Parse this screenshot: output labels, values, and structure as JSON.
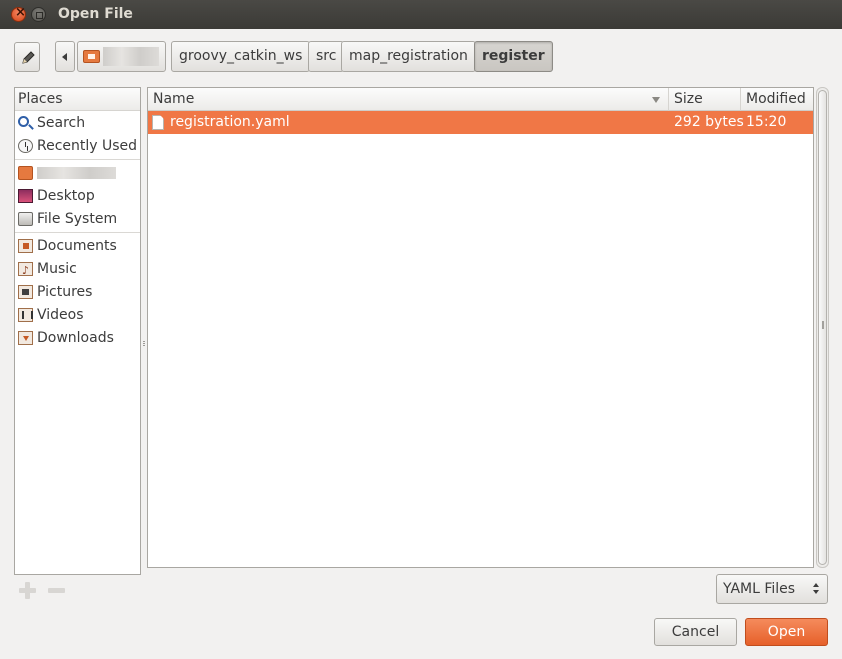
{
  "window": {
    "title": "Open File"
  },
  "pathbar": {
    "crumbs": [
      "groovy_catkin_ws",
      "src",
      "map_registration",
      "register"
    ]
  },
  "places": {
    "header": "Places",
    "items": [
      {
        "label": "Search",
        "icon": "search-icon"
      },
      {
        "label": "Recently Used",
        "icon": "recently-used-icon"
      },
      {
        "label": "",
        "icon": "home-folder-icon"
      },
      {
        "label": "Desktop",
        "icon": "desktop-icon"
      },
      {
        "label": "File System",
        "icon": "file-system-icon"
      },
      {
        "label": "Documents",
        "icon": "documents-folder-icon"
      },
      {
        "label": "Music",
        "icon": "music-folder-icon"
      },
      {
        "label": "Pictures",
        "icon": "pictures-folder-icon"
      },
      {
        "label": "Videos",
        "icon": "videos-folder-icon"
      },
      {
        "label": "Downloads",
        "icon": "downloads-folder-icon"
      }
    ]
  },
  "file_list": {
    "columns": [
      "Name",
      "Size",
      "Modified"
    ],
    "rows": [
      {
        "name": "registration.yaml",
        "size": "292 bytes",
        "modified": "15:20",
        "selected": true
      }
    ]
  },
  "filter": {
    "selected": "YAML Files"
  },
  "buttons": {
    "cancel": "Cancel",
    "open": "Open"
  },
  "colors": {
    "accent": "#f07746",
    "titlebar": "#3c3b37",
    "background": "#f2f1f0"
  }
}
